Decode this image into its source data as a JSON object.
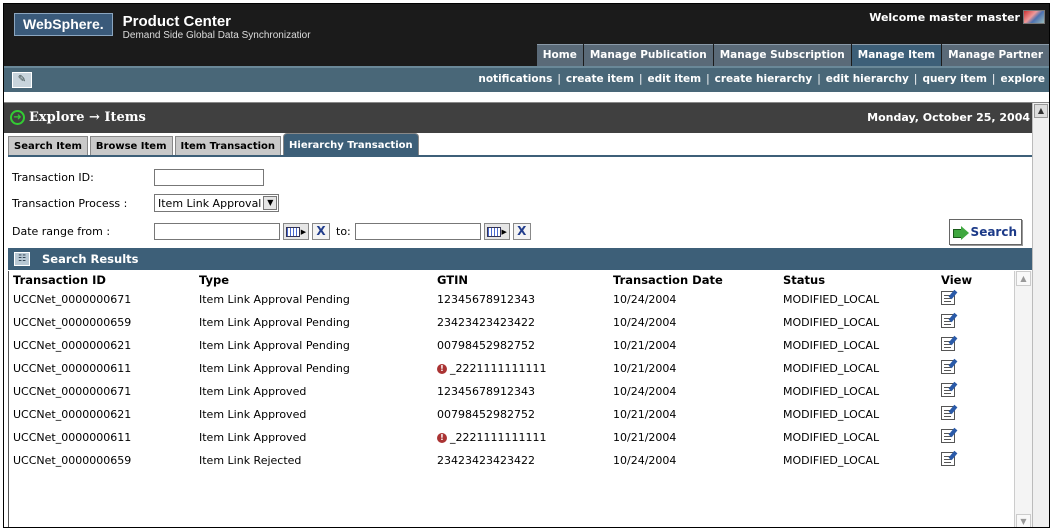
{
  "header": {
    "logo": "WebSphere.",
    "product_title": "Product Center",
    "product_subtitle": "Demand Side Global Data Synchronizatior",
    "welcome": "Welcome master master",
    "nav_tabs": [
      "Home",
      "Manage Publication",
      "Manage Subscription",
      "Manage Item",
      "Manage Partner"
    ],
    "active_nav": "Manage Item"
  },
  "subbar": {
    "links": [
      "notifications",
      "create item",
      "edit item",
      "create hierarchy",
      "edit hierarchy",
      "query item",
      "explore"
    ]
  },
  "explore": {
    "title": "Explore → Items",
    "date": "Monday, October 25, 2004"
  },
  "tabs": [
    "Search Item",
    "Browse Item",
    "Item Transaction",
    "Hierarchy Transaction"
  ],
  "active_tab": "Hierarchy Transaction",
  "form": {
    "transaction_id_label": "Transaction ID:",
    "transaction_id_value": "",
    "transaction_process_label": "Transaction Process :",
    "transaction_process_value": "Item Link Approval",
    "date_from_label": "Date range from :",
    "date_to_label": "to:",
    "clear_label": "X",
    "search_label": "Search"
  },
  "results": {
    "title": "Search Results",
    "columns": [
      "Transaction ID",
      "Type",
      "GTIN",
      "Transaction Date",
      "Status",
      "View"
    ],
    "rows": [
      {
        "id": "UCCNet_0000000671",
        "type": "Item Link Approval Pending",
        "gtin": "12345678912343",
        "warn": false,
        "date": "10/24/2004",
        "status": "MODIFIED_LOCAL"
      },
      {
        "id": "UCCNet_0000000659",
        "type": "Item Link Approval Pending",
        "gtin": "23423423423422",
        "warn": false,
        "date": "10/24/2004",
        "status": "MODIFIED_LOCAL"
      },
      {
        "id": "UCCNet_0000000621",
        "type": "Item Link Approval Pending",
        "gtin": "00798452982752",
        "warn": false,
        "date": "10/21/2004",
        "status": "MODIFIED_LOCAL"
      },
      {
        "id": "UCCNet_0000000611",
        "type": "Item Link Approval Pending",
        "gtin": "_2221111111111",
        "warn": true,
        "date": "10/21/2004",
        "status": "MODIFIED_LOCAL"
      },
      {
        "id": "UCCNet_0000000671",
        "type": "Item Link Approved",
        "gtin": "12345678912343",
        "warn": false,
        "date": "10/24/2004",
        "status": "MODIFIED_LOCAL"
      },
      {
        "id": "UCCNet_0000000621",
        "type": "Item Link Approved",
        "gtin": "00798452982752",
        "warn": false,
        "date": "10/21/2004",
        "status": "MODIFIED_LOCAL"
      },
      {
        "id": "UCCNet_0000000611",
        "type": "Item Link Approved",
        "gtin": "_2221111111111",
        "warn": true,
        "date": "10/21/2004",
        "status": "MODIFIED_LOCAL"
      },
      {
        "id": "UCCNet_0000000659",
        "type": "Item Link Rejected",
        "gtin": "23423423423422",
        "warn": false,
        "date": "10/24/2004",
        "status": "MODIFIED_LOCAL"
      }
    ]
  }
}
